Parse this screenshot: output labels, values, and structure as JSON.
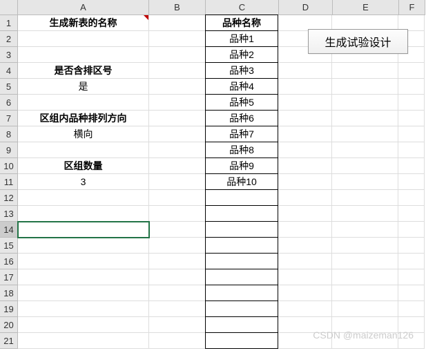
{
  "columns": [
    "A",
    "B",
    "C",
    "D",
    "E",
    "F"
  ],
  "rows": [
    "1",
    "2",
    "3",
    "4",
    "5",
    "6",
    "7",
    "8",
    "9",
    "10",
    "11",
    "12",
    "13",
    "14",
    "15",
    "16",
    "17",
    "18",
    "19",
    "20",
    "21"
  ],
  "colA": {
    "r1": "生成新表的名称",
    "r4": "是否含排区号",
    "r5": "是",
    "r7": "区组内品种排列方向",
    "r8": "横向",
    "r10": "区组数量",
    "r11": "3"
  },
  "colC": {
    "r1": "品种名称",
    "r2": "品种1",
    "r3": "品种2",
    "r4": "品种3",
    "r5": "品种4",
    "r6": "品种5",
    "r7": "品种6",
    "r8": "品种7",
    "r9": "品种8",
    "r10": "品种9",
    "r11": "品种10"
  },
  "button": {
    "label": "生成试验设计"
  },
  "watermark": "CSDN @maizeman126",
  "selected_cell": "A14"
}
